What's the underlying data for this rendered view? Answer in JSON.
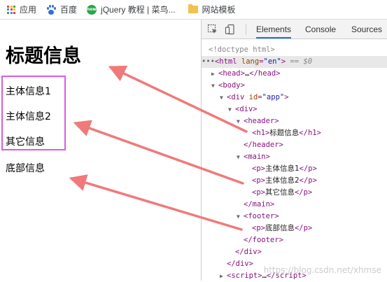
{
  "bookmarks": [
    {
      "label": "应用",
      "icon": "apps-grid-icon"
    },
    {
      "label": "百度",
      "icon": "baidu-paw-icon"
    },
    {
      "label": "jQuery 教程 | 菜鸟...",
      "icon": "jquery-icon"
    },
    {
      "label": "网站模板",
      "icon": "folder-icon"
    }
  ],
  "page": {
    "title": "标题信息",
    "main_items": [
      "主体信息1",
      "主体信息2",
      "其它信息"
    ],
    "footer_text": "底部信息"
  },
  "devtools": {
    "tabs": [
      "Elements",
      "Console",
      "Sources"
    ],
    "active_tab": "Elements",
    "doctype": "<!doctype html>",
    "selected_suffix": "== $0",
    "h1_text": "标题信息",
    "p1_text": "主体信息1",
    "p2_text": "主体信息2",
    "p3_text": "其它信息",
    "footer_p_text": "底部信息",
    "app_id": "\"app\"",
    "lang_val": "\"en\""
  },
  "watermark": "https://blog.csdn.net/xhmse",
  "colors": {
    "highlight_box": "#d75de0",
    "arrow": "#f07a7a",
    "tag": "#881280",
    "attr": "#994500",
    "active_tab": "#1a73e8"
  }
}
